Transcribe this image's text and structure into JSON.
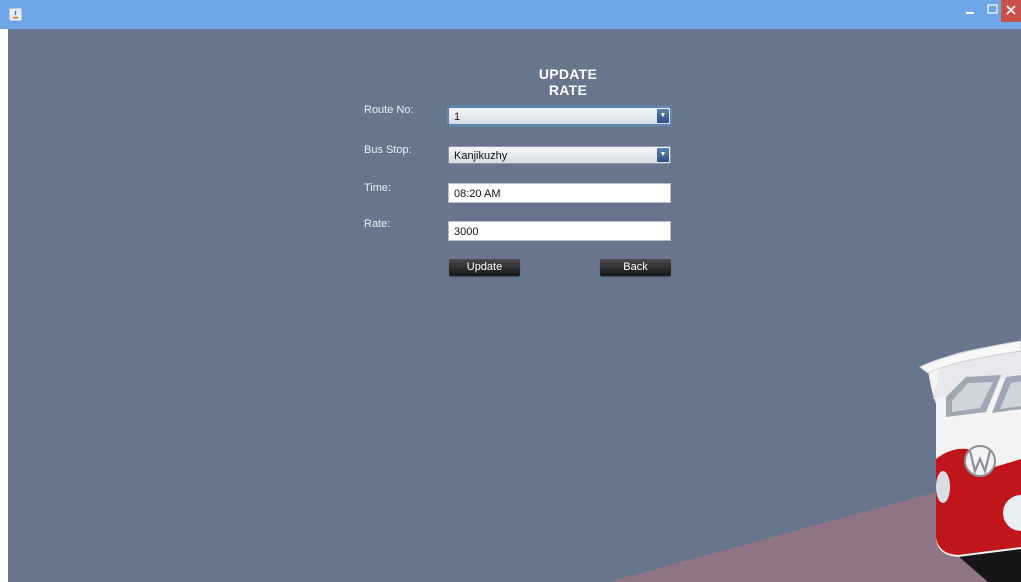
{
  "window": {
    "controls": [
      "minimize-icon",
      "maximize-icon",
      "close-icon"
    ]
  },
  "form": {
    "title": "UPDATE RATE",
    "route_label": "Route No:",
    "route_value": "1",
    "stop_label": "Bus Stop:",
    "stop_value": "Kanjikuzhy",
    "time_label": "Time:",
    "time_value": "08:20 AM",
    "rate_label": "Rate:",
    "rate_value": "3000",
    "update_label": "Update",
    "back_label": "Back"
  },
  "colors": {
    "titlebar": "#6fa6e8",
    "background": "#67768c",
    "bus_red": "#c0161b",
    "floor": "#8f7583"
  }
}
